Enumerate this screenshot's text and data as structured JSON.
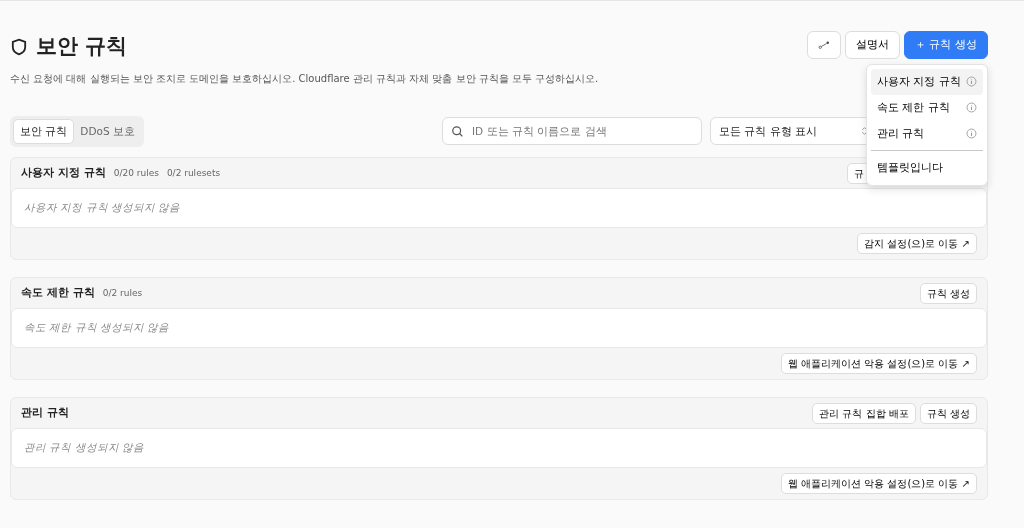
{
  "page": {
    "title": "보안 규칙",
    "description": "수신 요청에 대해 실행되는 보안 조치로 도메인을 보호하십시오. Cloudflare 관리 규칙과 자체 맞춤 보안 규칙을 모두 구성하십시오."
  },
  "header_buttons": [
    {
      "kind": "icon"
    },
    {
      "kind": "text",
      "label": "설명서"
    },
    {
      "kind": "primary",
      "label": "＋ 규칙 생성"
    }
  ],
  "dropdown": [
    {
      "label": "사용자 지정 규칙",
      "info": true,
      "selected": true
    },
    {
      "label": "속도 제한 규칙",
      "info": true,
      "selected": false
    },
    {
      "label": "관리 규칙",
      "info": true,
      "selected": false
    },
    {
      "label": "템플릿입니다",
      "info": false,
      "selected": false
    }
  ],
  "tabs": [
    {
      "label": "보안 규칙",
      "selected": true
    },
    {
      "label": "DDoS 보호",
      "selected": false
    }
  ],
  "search": {
    "placeholder": "ID 또는 규칙 이름으로 검색"
  },
  "filter": {
    "value": "모든 규칙 유형 표시"
  },
  "sections": [
    {
      "title": "사용자 지정 규칙",
      "counts": [
        "0/20 rules",
        "0/2 rulesets"
      ],
      "buttons": [
        "규"
      ],
      "empty": "사용자 지정 규칙 생성되지 않음",
      "link": "감지 설정(으)로 이동 ↗"
    },
    {
      "title": "속도 제한 규칙",
      "counts": [
        "0/2 rules"
      ],
      "buttons": [
        "규칙 생성"
      ],
      "empty": "속도 제한 규칙 생성되지 않음",
      "link": "웹 애플리케이션 악용 설정(으)로 이동 ↗"
    },
    {
      "title": "관리 규칙",
      "buttons": [
        "관리 규칙 집합 배포",
        "규칙 생성"
      ],
      "empty": "관리 규칙 생성되지 않음",
      "link": "웹 애플리케이션 악용 설정(으)로 이동 ↗"
    }
  ]
}
